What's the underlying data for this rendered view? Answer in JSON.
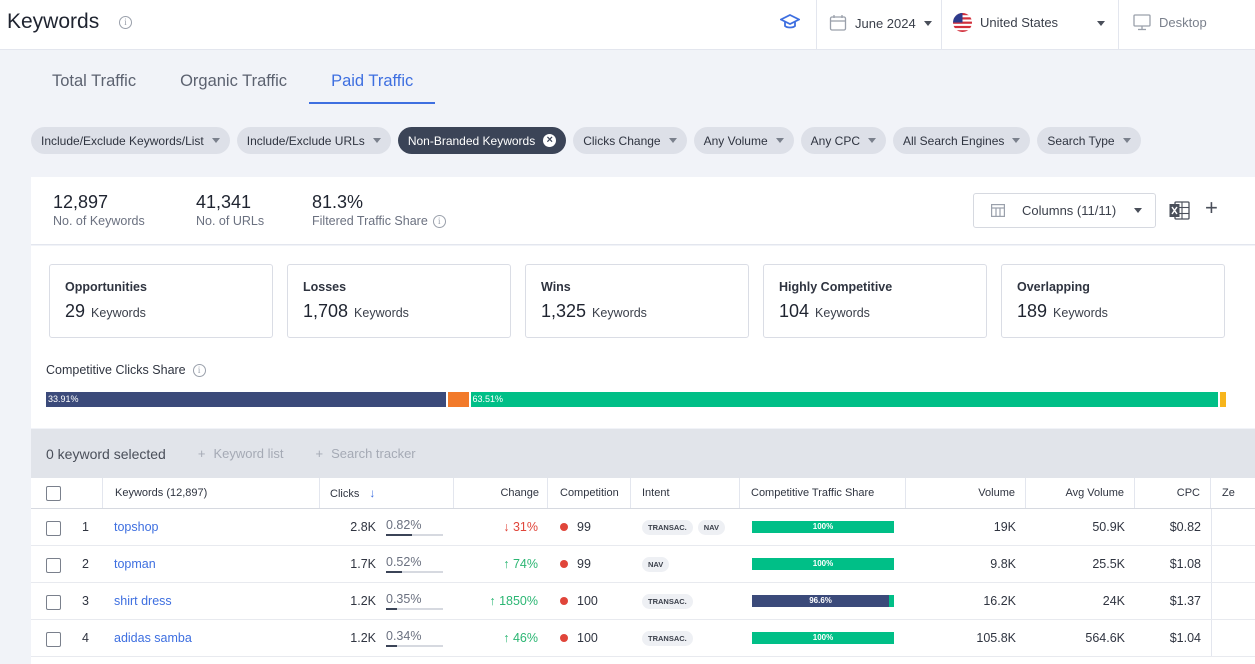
{
  "header": {
    "title": "Keywords",
    "date": "June 2024",
    "country": "United States",
    "device": "Desktop"
  },
  "tabs": [
    "Total Traffic",
    "Organic Traffic",
    "Paid Traffic"
  ],
  "active_tab": "Paid Traffic",
  "filters": [
    {
      "label": "Include/Exclude Keywords/List",
      "active": false
    },
    {
      "label": "Include/Exclude URLs",
      "active": false
    },
    {
      "label": "Non-Branded Keywords",
      "active": true
    },
    {
      "label": "Clicks Change",
      "active": false
    },
    {
      "label": "Any Volume",
      "active": false
    },
    {
      "label": "Any CPC",
      "active": false
    },
    {
      "label": "All Search Engines",
      "active": false
    },
    {
      "label": "Search Type",
      "active": false
    }
  ],
  "summary": {
    "keywords_value": "12,897",
    "keywords_label": "No. of Keywords",
    "urls_value": "41,341",
    "urls_label": "No. of URLs",
    "share_value": "81.3%",
    "share_label": "Filtered Traffic Share",
    "columns_label": "Columns (11/11)"
  },
  "cards": [
    {
      "title": "Opportunities",
      "value": "29",
      "unit": "Keywords"
    },
    {
      "title": "Losses",
      "value": "1,708",
      "unit": "Keywords"
    },
    {
      "title": "Wins",
      "value": "1,325",
      "unit": "Keywords"
    },
    {
      "title": "Highly Competitive",
      "value": "104",
      "unit": "Keywords"
    },
    {
      "title": "Overlapping",
      "value": "189",
      "unit": "Keywords"
    }
  ],
  "competitive_share": {
    "title": "Competitive Clicks Share",
    "segments": [
      {
        "label": "33.91%",
        "share": 33.91,
        "color": "#3b4a7a"
      },
      {
        "label": "",
        "share": 1.9,
        "color": "#f27a2a"
      },
      {
        "label": "63.51%",
        "share": 63.51,
        "color": "#00bf87"
      },
      {
        "label": "",
        "share": 0.68,
        "color": "#f7b51c"
      }
    ]
  },
  "selection": {
    "selected_text": "0 keyword selected",
    "keyword_list": "Keyword list",
    "search_tracker": "Search tracker"
  },
  "table": {
    "headers": {
      "keywords": "Keywords (12,897)",
      "clicks": "Clicks",
      "change": "Change",
      "competition": "Competition",
      "intent": "Intent",
      "cts": "Competitive Traffic Share",
      "volume": "Volume",
      "avg_volume": "Avg Volume",
      "cpc": "CPC",
      "extra": "Ze"
    },
    "rows": [
      {
        "num": "1",
        "keyword": "topshop",
        "clicks": "2.8K",
        "share": "0.82%",
        "share_fill": 0.82,
        "change": "31%",
        "change_dir": "down",
        "competition": "99",
        "intents": [
          "TRANSAC.",
          "NAV"
        ],
        "cts_label": "100%",
        "cts_main": 100,
        "cts_color": "#00bf87",
        "volume": "19K",
        "avg_volume": "50.9K",
        "cpc": "$0.82"
      },
      {
        "num": "2",
        "keyword": "topman",
        "clicks": "1.7K",
        "share": "0.52%",
        "share_fill": 0.52,
        "change": "74%",
        "change_dir": "up",
        "competition": "99",
        "intents": [
          "NAV"
        ],
        "cts_label": "100%",
        "cts_main": 100,
        "cts_color": "#00bf87",
        "volume": "9.8K",
        "avg_volume": "25.5K",
        "cpc": "$1.08"
      },
      {
        "num": "3",
        "keyword": "shirt dress",
        "clicks": "1.2K",
        "share": "0.35%",
        "share_fill": 0.35,
        "change": "1850%",
        "change_dir": "up",
        "competition": "100",
        "intents": [
          "TRANSAC."
        ],
        "cts_label": "96.6%",
        "cts_main": 96.6,
        "cts_color": "#3b4a7a",
        "volume": "16.2K",
        "avg_volume": "24K",
        "cpc": "$1.37"
      },
      {
        "num": "4",
        "keyword": "adidas samba",
        "clicks": "1.2K",
        "share": "0.34%",
        "share_fill": 0.34,
        "change": "46%",
        "change_dir": "up",
        "competition": "100",
        "intents": [
          "TRANSAC."
        ],
        "cts_label": "100%",
        "cts_main": 100,
        "cts_color": "#00bf87",
        "volume": "105.8K",
        "avg_volume": "564.6K",
        "cpc": "$1.04"
      }
    ]
  }
}
